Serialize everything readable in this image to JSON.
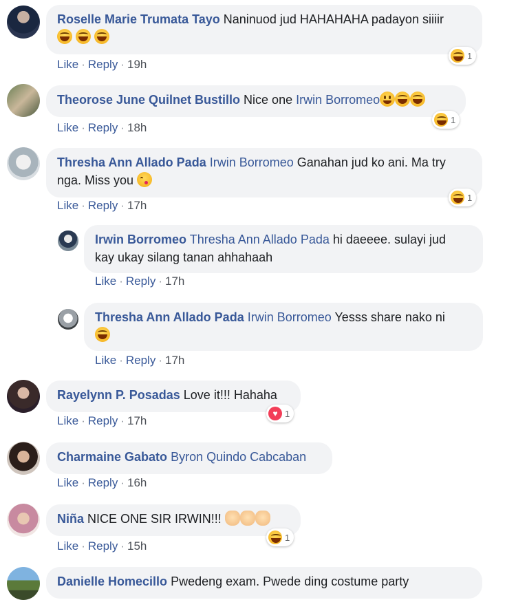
{
  "comments": [
    {
      "author": "Roselle Marie Trumata Tayo",
      "text": "Naninuod jud HAHAHAHA padayon siiiir",
      "emojis": [
        "laugh",
        "laugh",
        "laugh"
      ],
      "like_label": "Like",
      "reply_label": "Reply",
      "time": "19h",
      "reaction": {
        "icon": "laugh-reaction-icon",
        "count": "1"
      }
    },
    {
      "author": "Theorose June Quilnet Bustillo",
      "text": "Nice one",
      "mention": "Irwin Borromeo",
      "emojis": [
        "grin",
        "rolling-laugh",
        "laugh"
      ],
      "like_label": "Like",
      "reply_label": "Reply",
      "time": "18h",
      "reaction": {
        "icon": "laugh-reaction-icon",
        "count": "1"
      }
    },
    {
      "author": "Thresha Ann Allado Pada",
      "mention": "Irwin Borromeo",
      "text": "Ganahan jud ko ani. Ma try",
      "text_line2": "nga. Miss you",
      "emojis": [
        "kiss"
      ],
      "like_label": "Like",
      "reply_label": "Reply",
      "time": "17h",
      "reaction": {
        "icon": "laugh-reaction-icon",
        "count": "1"
      },
      "replies": [
        {
          "author": "Irwin Borromeo",
          "mention": "Thresha Ann Allado Pada",
          "text": "hi daeeee. sulayi jud",
          "text_line2": "kay ukay silang tanan ahhahaah",
          "like_label": "Like",
          "reply_label": "Reply",
          "time": "17h"
        },
        {
          "author": "Thresha Ann Allado Pada",
          "mention": "Irwin Borromeo",
          "text": "Yesss share nako ni",
          "emojis": [
            "laugh"
          ],
          "like_label": "Like",
          "reply_label": "Reply",
          "time": "17h"
        }
      ]
    },
    {
      "author": "Rayelynn P. Posadas",
      "text": "Love it!!! Hahaha",
      "like_label": "Like",
      "reply_label": "Reply",
      "time": "17h",
      "reaction": {
        "icon": "heart-reaction-icon",
        "count": "1"
      }
    },
    {
      "author": "Charmaine Gabato",
      "mention": "Byron Quindo Cabcaban",
      "like_label": "Like",
      "reply_label": "Reply",
      "time": "16h"
    },
    {
      "author": "Niña",
      "text": "NICE ONE SIR IRWIN!!!",
      "emojis": [
        "clap",
        "clap",
        "clap"
      ],
      "like_label": "Like",
      "reply_label": "Reply",
      "time": "15h",
      "reaction": {
        "icon": "laugh-reaction-icon",
        "count": "1"
      }
    },
    {
      "author": "Danielle Homecillo",
      "text": "Pwedeng exam. Pwede ding costume party"
    }
  ],
  "colors": {
    "author": "#385898",
    "bubble": "#f2f3f5",
    "text": "#1c1e21",
    "heart": "#f33e58"
  }
}
